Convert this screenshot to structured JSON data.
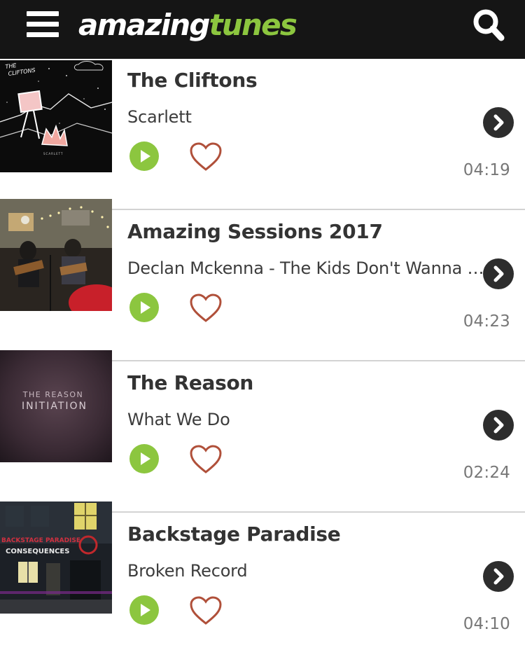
{
  "header": {
    "logo_part1": "amazing",
    "logo_part2": "tunes",
    "brand_color": "#8cc63f",
    "bar_color": "#151515",
    "menu_icon": "hamburger-menu-icon",
    "search_icon": "search-icon"
  },
  "tracks": [
    {
      "artist": "The Cliftons",
      "title": "Scarlett",
      "duration": "04:19",
      "cover": {
        "text_top": "THE CLIFTONS",
        "text_bottom": "SCARLETT"
      }
    },
    {
      "artist": "Amazing Sessions 2017",
      "title": "Declan Mckenna - The Kids Don't Wanna Come Home",
      "duration": "04:23",
      "cover": {}
    },
    {
      "artist": "The Reason",
      "title": "What We Do",
      "duration": "02:24",
      "cover": {
        "text_top": "THE REASON",
        "text_bottom": "INITIATION"
      }
    },
    {
      "artist": "Backstage Paradise",
      "title": "Broken Record",
      "duration": "04:10",
      "cover": {
        "text_top": "BACKSTAGE PARADISE",
        "text_bottom": "CONSEQUENCES"
      }
    }
  ],
  "colors": {
    "play": "#8cc63f",
    "heart": "#b0503a",
    "go_button": "#2d2d2d",
    "divider": "#d3d3d3"
  }
}
